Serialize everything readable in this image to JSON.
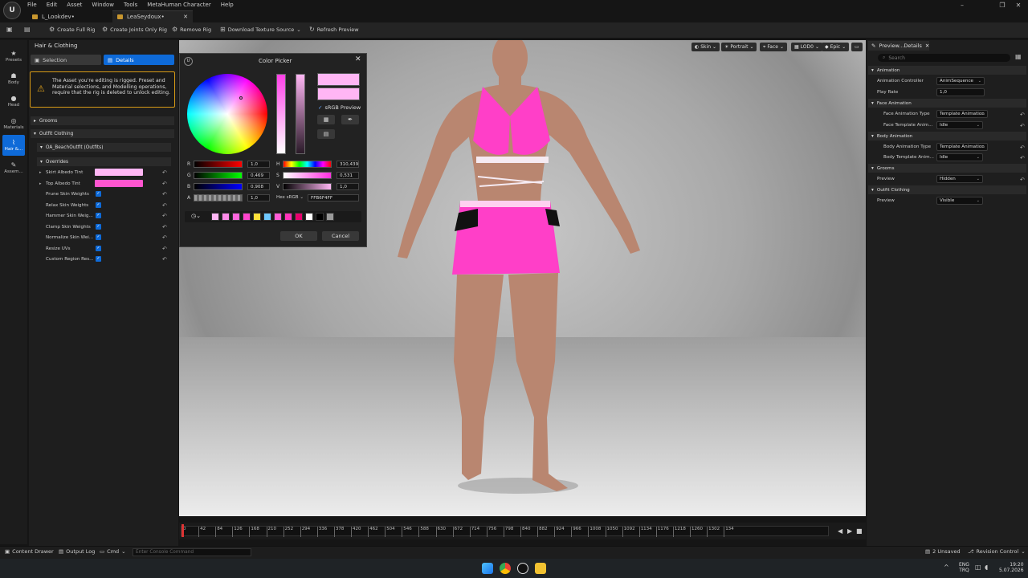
{
  "menu": [
    "File",
    "Edit",
    "Asset",
    "Window",
    "Tools",
    "MetaHuman Character",
    "Help"
  ],
  "tabs": [
    "L_Lookdev•",
    "LeaSeydoux•"
  ],
  "toolbar": [
    "Create Full Rig",
    "Create Joints Only Rig",
    "Remove Rig",
    "Download Texture Source",
    "Refresh Preview"
  ],
  "rail": [
    "Presets",
    "Body",
    "Head",
    "Materials",
    "Hair &...",
    "Assem..."
  ],
  "left": {
    "title": "Hair & Clothing",
    "selection": "Selection",
    "details": "Details",
    "warning": "The Asset you're editing is rigged. Preset and Material selections, and Modelling operations, require that the rig is deleted to unlock editing.",
    "grooms": "Grooms",
    "outfit": "Outfit Clothing",
    "outfit_item": "OA_BeachOutfit (Outfits)",
    "overrides": "Overrides",
    "skirt_tint": "Skirt Albedo Tint",
    "top_tint": "Top Albedo Tint",
    "props": [
      "Prune Skin Weights",
      "Relax Skin Weights",
      "Hammer Skin Weig...",
      "Clamp Skin Weights",
      "Normalize Skin Wei...",
      "Resize UVs",
      "Custom Region Res..."
    ]
  },
  "viewport_tags": [
    "Skin",
    "Portrait",
    "Face",
    "LOD0",
    "Epic"
  ],
  "picker": {
    "title": "Color Picker",
    "srgb_preview": "sRGB Preview",
    "r": "1,0",
    "g": "0,469",
    "b": "0,908",
    "a": "1,0",
    "h": "310,439",
    "s": "0,531",
    "v": "1,0",
    "hex_label": "Hex sRGB",
    "hex": "FFB6F4FF",
    "ok": "OK",
    "cancel": "Cancel",
    "palette": [
      "#ffb6f4",
      "#ff8ae8",
      "#ff66dd",
      "#ff44cc",
      "#ffe13a",
      "#6ec8ff",
      "#ff5cd6",
      "#ff33bb",
      "#e8006e",
      "#ffffff",
      "#000000",
      "#9a9a9a"
    ]
  },
  "right": {
    "tab": "Preview...Details",
    "search": "Search",
    "animation": "Animation",
    "anim_controller": "Animation Controller",
    "anim_controller_val": "AnimSequence",
    "play_rate": "Play Rate",
    "play_rate_val": "1,0",
    "face_anim": "Face Animation",
    "face_anim_type": "Face Animation Type",
    "face_anim_type_val": "Template Animation",
    "face_template": "Face Template Anim...",
    "face_template_val": "Idle",
    "body_anim": "Body Animation",
    "body_anim_type": "Body Animation Type",
    "body_anim_type_val": "Template Animation",
    "body_template": "Body Template Anim...",
    "body_template_val": "Idle",
    "grooms": "Grooms",
    "grooms_preview": "Preview",
    "grooms_preview_val": "Hidden",
    "outfit": "Outfit Clothing",
    "outfit_preview": "Preview",
    "outfit_preview_val": "Visible"
  },
  "timeline": [
    "0",
    "42",
    "84",
    "126",
    "168",
    "210",
    "252",
    "294",
    "336",
    "378",
    "420",
    "462",
    "504",
    "546",
    "588",
    "630",
    "672",
    "714",
    "756",
    "798",
    "840",
    "882",
    "924",
    "966",
    "1008",
    "1050",
    "1092",
    "1134",
    "1176",
    "1218",
    "1260",
    "1302",
    "134"
  ],
  "status": {
    "content_drawer": "Content Drawer",
    "output_log": "Output Log",
    "cmd": "Cmd",
    "console": "Enter Console Command",
    "unsaved": "2 Unsaved",
    "revision": "Revision Control"
  },
  "tray": {
    "lang1": "ENG",
    "lang2": "TRQ",
    "time": "19:20",
    "date": "5.07.2026"
  },
  "colors": {
    "accent": "#0e6ad8",
    "warning": "#d89a16",
    "outfit_pink": "#ff3fc8",
    "tint_light": "#ffb6f4",
    "tint_strong": "#ff55cf"
  }
}
